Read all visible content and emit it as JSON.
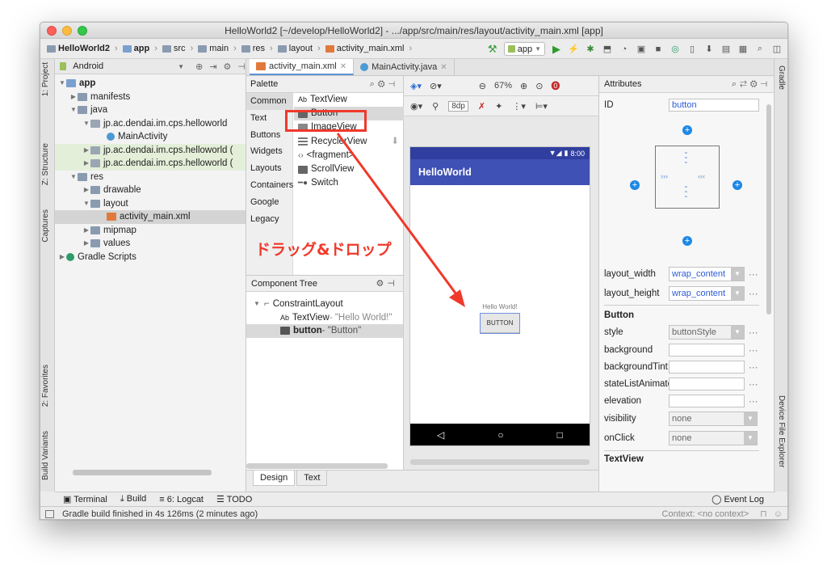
{
  "window": {
    "title": "HelloWorld2 [~/develop/HelloWorld2] - .../app/src/main/res/layout/activity_main.xml [app]"
  },
  "breadcrumb": {
    "items": [
      "HelloWorld2",
      "app",
      "src",
      "main",
      "res",
      "layout",
      "activity_main.xml"
    ]
  },
  "toolbar": {
    "run_config": "app"
  },
  "side_tabs": {
    "project": "1: Project",
    "structure": "Z: Structure",
    "captures": "Captures",
    "favorites": "2: Favorites",
    "build_variants": "Build Variants",
    "gradle": "Gradle",
    "device_file_explorer": "Device File Explorer"
  },
  "project": {
    "view_mode": "Android",
    "tree": [
      "app",
      "manifests",
      "java",
      "jp.ac.dendai.im.cps.helloworld",
      "MainActivity",
      "jp.ac.dendai.im.cps.helloworld (",
      "jp.ac.dendai.im.cps.helloworld (",
      "res",
      "drawable",
      "layout",
      "activity_main.xml",
      "mipmap",
      "values",
      "Gradle Scripts"
    ]
  },
  "editor_tabs": [
    "activity_main.xml",
    "MainActivity.java"
  ],
  "palette": {
    "title": "Palette",
    "categories": [
      "Common",
      "Text",
      "Buttons",
      "Widgets",
      "Layouts",
      "Containers",
      "Google",
      "Legacy"
    ],
    "items": [
      "TextView",
      "Button",
      "ImageView",
      "RecyclerView",
      "<fragment>",
      "ScrollView",
      "Switch"
    ],
    "text_icon": "Ab"
  },
  "annotation": {
    "label": "ドラッグ&ドロップ"
  },
  "component_tree": {
    "title": "Component Tree",
    "root": "ConstraintLayout",
    "text_icon": "Ab",
    "children": [
      {
        "name": "TextView",
        "detail": " - \"Hello World!\""
      },
      {
        "name": "button",
        "detail": " - \"Button\""
      }
    ]
  },
  "design": {
    "zoom": "67%",
    "margin": "8dp",
    "status_time": "8:00",
    "app_title": "HelloWorld",
    "hello": "Hello World!",
    "button_text": "BUTTON"
  },
  "bottom_tabs": [
    "Design",
    "Text"
  ],
  "attributes": {
    "title": "Attributes",
    "id_label": "ID",
    "id_value": "button",
    "layout_width_label": "layout_width",
    "layout_width": "wrap_content",
    "layout_height_label": "layout_height",
    "layout_height": "wrap_content",
    "section_button": "Button",
    "rows": [
      {
        "label": "style",
        "value": "buttonStyle"
      },
      {
        "label": "background",
        "value": ""
      },
      {
        "label": "backgroundTint",
        "value": ""
      },
      {
        "label": "stateListAnimator",
        "value": ""
      },
      {
        "label": "elevation",
        "value": ""
      },
      {
        "label": "visibility",
        "value": "none"
      },
      {
        "label": "onClick",
        "value": "none"
      }
    ],
    "section_textview": "TextView"
  },
  "tool_windows": {
    "terminal": "Terminal",
    "build": "Build",
    "logcat": "6: Logcat",
    "todo": "TODO",
    "event_log": "Event Log"
  },
  "status": {
    "message": "Gradle build finished in 4s 126ms (2 minutes ago)",
    "context": "Context: <no context>"
  }
}
